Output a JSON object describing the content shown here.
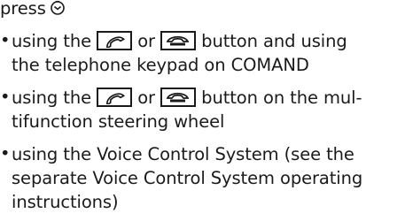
{
  "intro": {
    "text": "press",
    "icon": "rotary-press-icon"
  },
  "bullets": [
    {
      "marker": "•",
      "line1_pre": "using the",
      "icon_a": "phone-call-icon",
      "mid": "or",
      "icon_b": "phone-end-icon",
      "line1_post": "button and using",
      "line2": "the telephone keypad on COMAND"
    },
    {
      "marker": "•",
      "line1_pre": "using the",
      "icon_a": "phone-call-icon",
      "mid": "or",
      "icon_b": "phone-end-icon",
      "line1_post": "button on the mul-",
      "line2": "tifunction steering wheel"
    },
    {
      "marker": "•",
      "line1": "using the Voice Control System (see the",
      "line2": "separate Voice Control System operating",
      "line3": "instructions)"
    }
  ]
}
